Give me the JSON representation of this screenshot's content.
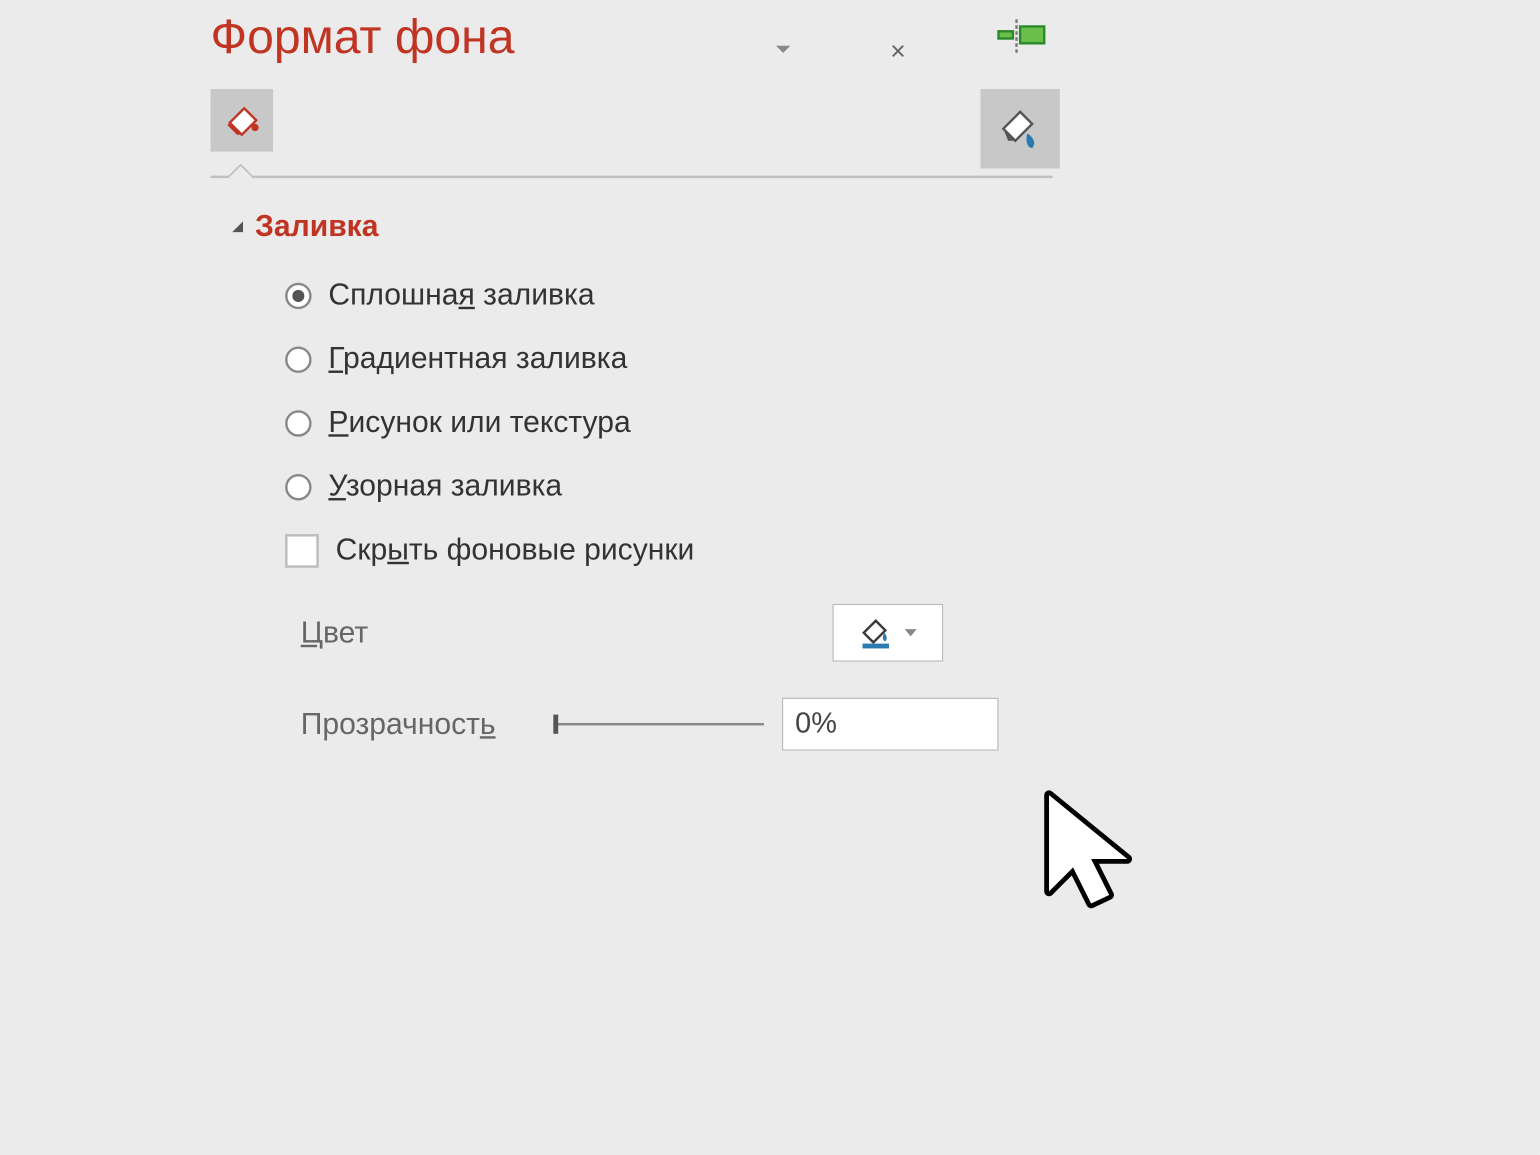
{
  "panel": {
    "title": "Формат фона",
    "close": "×"
  },
  "section": {
    "title": "Заливка"
  },
  "fill_options": [
    {
      "label_pre": "Сплошна",
      "u": "я",
      "label_post": " заливка",
      "selected": true
    },
    {
      "label_pre": "",
      "u": "Г",
      "label_post": "радиентная заливка",
      "selected": false
    },
    {
      "label_pre": "",
      "u": "Р",
      "label_post": "исунок или текстура",
      "selected": false
    },
    {
      "label_pre": "",
      "u": "У",
      "label_post": "зорная заливка",
      "selected": false
    }
  ],
  "hide_bg": {
    "label_pre": "Скр",
    "u": "ы",
    "label_post": "ть фоновые рисунки",
    "checked": false
  },
  "color": {
    "label_pre": "",
    "u": "Ц",
    "label_post": "вет"
  },
  "transparency": {
    "label_pre": "Прозрачност",
    "u": "ь",
    "label_post": "",
    "value": "0%"
  }
}
